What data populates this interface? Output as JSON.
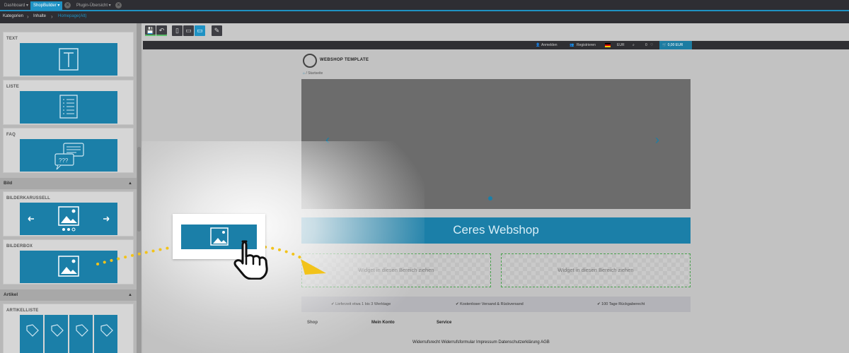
{
  "app": {
    "tabs": [
      {
        "label": "Dashboard ▾",
        "active": false
      },
      {
        "label": "ShopBuilder ▾",
        "active": true
      },
      {
        "label": "Plugin-Übersicht ▾",
        "active": false
      }
    ],
    "breadcrumb": [
      "Kategorien",
      "Inhalte",
      "Homepage(Alt)"
    ]
  },
  "sidebar": {
    "widgets_text": [
      {
        "label": "TEXT",
        "icon": "text-icon"
      },
      {
        "label": "LISTE",
        "icon": "list-icon"
      },
      {
        "label": "FAQ",
        "icon": "faq-icon"
      }
    ],
    "section_bild": "Bild",
    "widgets_bild": [
      {
        "label": "BILDERKARUSSELL",
        "icon": "carousel-icon"
      },
      {
        "label": "BILDERBOX",
        "icon": "image-icon"
      }
    ],
    "section_artikel": "Artikel",
    "widgets_artikel": [
      {
        "label": "ARTIKELLISTE",
        "icon": "tag-icon"
      }
    ]
  },
  "toolbar": {
    "buttons": [
      "save-icon",
      "undo-icon",
      "phone-icon",
      "tablet-icon",
      "desktop-icon",
      "pen-icon"
    ]
  },
  "shop": {
    "topbar": {
      "login": "Anmelden",
      "register": "Registrieren",
      "currency": "EUR",
      "wishlist_count": "0",
      "cart": "0,00 EUR"
    },
    "logo_text": "WEBSHOP TEMPLATE",
    "breadcrumb": "Startseite",
    "headline": "Ceres Webshop",
    "dropzone_text": "Widget in diesen Bereich ziehen",
    "infobar": [
      "✔ Lieferzeit etwa 1 bis 3 Werktage",
      "✔ Kostenloser Versand & Rückversand",
      "✔ 100 Tage Rückgaberecht"
    ],
    "footer_headings": [
      "Shop",
      "Mein Konto",
      "Service"
    ],
    "footer_links": [
      "Widerrufsrecht",
      "Widerrufsformular",
      "Impressum",
      "Datenschutzerklärung",
      "AGB"
    ]
  },
  "colors": {
    "accent": "#1f92c4",
    "widget_blue": "#1b7fa8",
    "dark": "#2e2e33",
    "drop_border": "#4aa14e",
    "dots": "#f2c31a"
  }
}
